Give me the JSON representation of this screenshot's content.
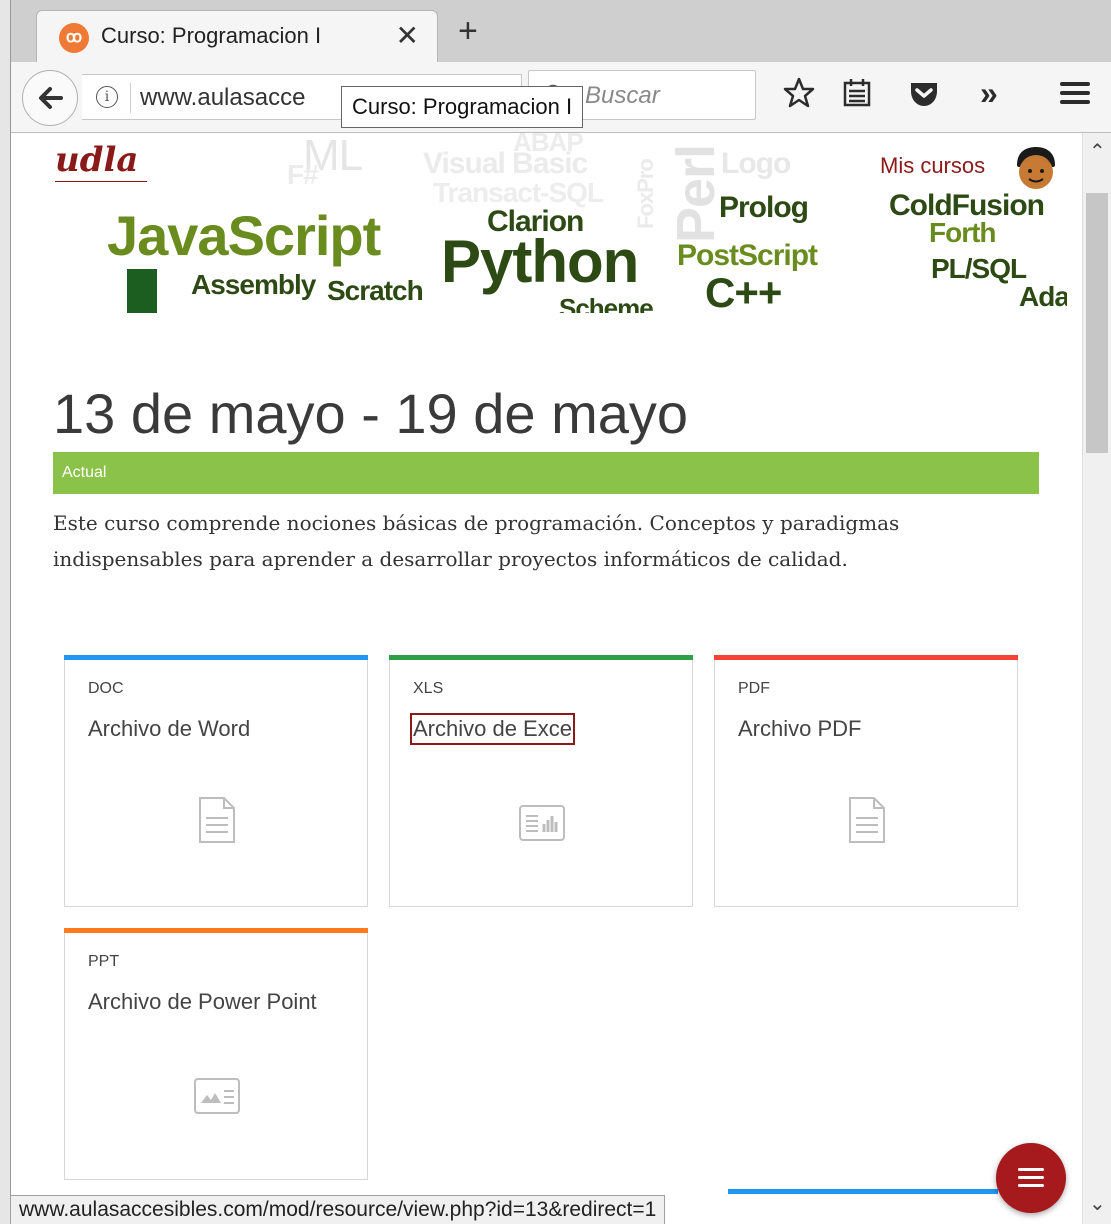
{
  "browser": {
    "tab_title": "Curso: Programacion I",
    "tab_favicon": "moodle-icon",
    "url_text": "www.aulasacce",
    "search_placeholder": "Buscar",
    "tooltip": "Curso: Programacion I",
    "status_url": "www.aulasaccesibles.com/mod/resource/view.php?id=13&redirect=1"
  },
  "header": {
    "mis_cursos": "Mis cursos",
    "banner_words": [
      "JavaScript",
      "Python",
      "Clarion",
      "Prolog",
      "ColdFusion",
      "Forth",
      "PostScript",
      "PL/SQL",
      "Assembly",
      "Scratch",
      "C++",
      "Scheme",
      "Ada",
      "Visual Basic",
      "Transact-SQL",
      "ABAP",
      "Logo",
      "ML",
      "F#",
      "FoxPro",
      "Perl"
    ]
  },
  "section": {
    "title": "13 de mayo - 19 de mayo",
    "current_label": "Actual",
    "summary": "Este curso comprende nociones básicas de programación. Conceptos y paradigmas indispensables para aprender a desarrollar proyectos informáticos de calidad."
  },
  "resources": [
    {
      "type": "DOC",
      "title": "Archivo de Word",
      "color": "#2196f3",
      "icon": "document-icon"
    },
    {
      "type": "XLS",
      "title": "Archivo de Exce",
      "color": "#2e9e48",
      "icon": "spreadsheet-icon"
    },
    {
      "type": "PDF",
      "title": "Archivo PDF",
      "color": "#f44336",
      "icon": "document-icon"
    },
    {
      "type": "PPT",
      "title": "Archivo de Power Point",
      "color": "#ff7a1a",
      "icon": "presentation-icon"
    }
  ]
}
